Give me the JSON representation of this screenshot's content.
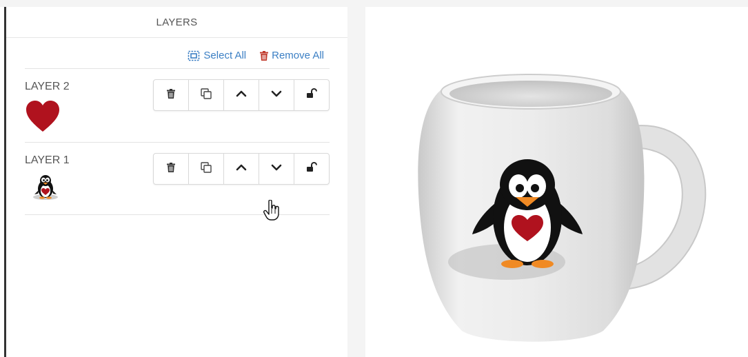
{
  "panel": {
    "title": "LAYERS",
    "select_all_label": "Select All",
    "remove_all_label": "Remove All"
  },
  "layers": [
    {
      "name": "LAYER 2",
      "thumbnail": "heart"
    },
    {
      "name": "LAYER 1",
      "thumbnail": "penguin"
    }
  ],
  "layer_buttons": [
    "trash-icon",
    "duplicate-icon",
    "chevron-up-icon",
    "chevron-down-icon",
    "unlock-icon"
  ],
  "colors": {
    "link_blue": "#3b7fc4",
    "remove_red": "#c0392b",
    "heart_red": "#b0121e",
    "sidebar_dark": "#333333"
  }
}
